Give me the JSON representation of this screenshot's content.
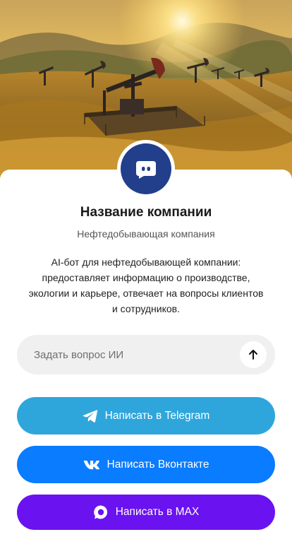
{
  "hero": {
    "image_icon": "oil-field-sunset-image"
  },
  "profile": {
    "avatar_icon": "chat-bot-icon",
    "company_name": "Название компании",
    "company_type": "Нефтедобывающая компания",
    "description": "AI-бот для нефтедобывающей компании: предоставляет информацию о производстве, экологии и карьере, отвечает на вопросы клиентов и сотрудников."
  },
  "ai_input": {
    "placeholder": "Задать вопрос ИИ",
    "send_icon": "arrow-up-icon"
  },
  "actions": {
    "telegram": {
      "label": "Написать в Telegram",
      "icon": "telegram-icon",
      "color": "#2ea6dc"
    },
    "vk": {
      "label": "Написать Вконтакте",
      "icon": "vk-icon",
      "color": "#0a7cff"
    },
    "max": {
      "label": "Написать в MAX",
      "icon": "max-icon",
      "color": "#6a12f0"
    }
  },
  "colors": {
    "avatar_bg": "#223f8c"
  }
}
